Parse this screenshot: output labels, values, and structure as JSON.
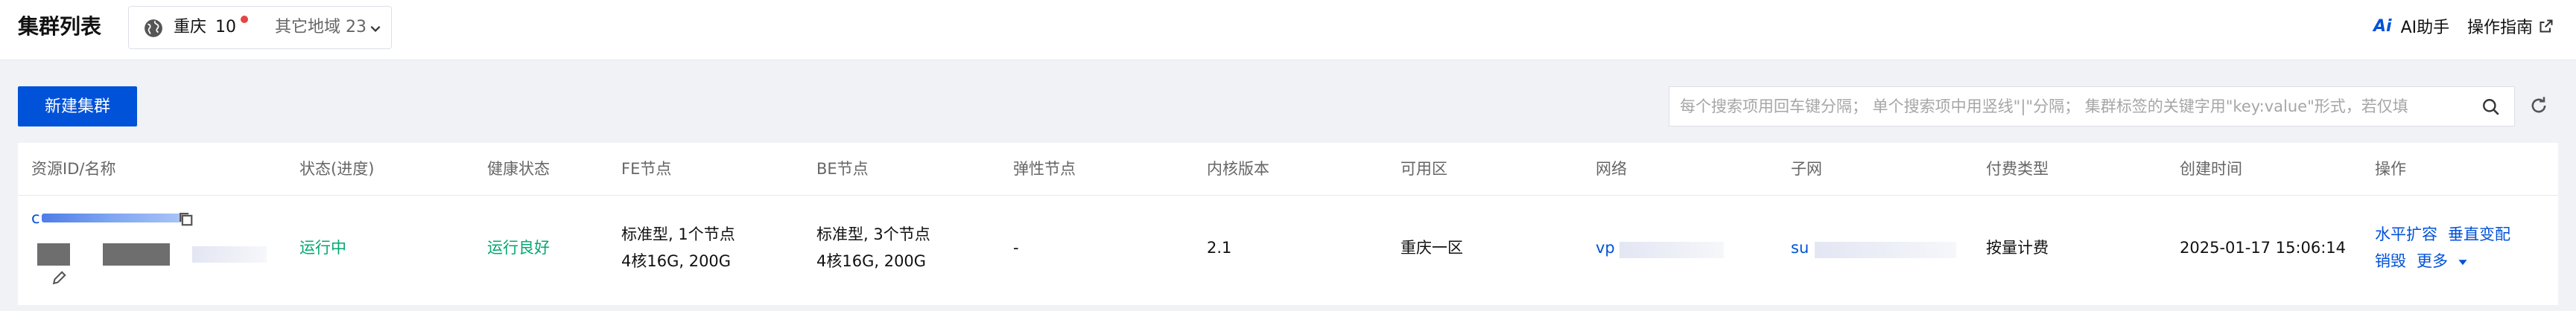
{
  "header": {
    "title": "集群列表",
    "region": {
      "name": "重庆",
      "count": "10",
      "icon": "globe-icon"
    },
    "other_region": "其它地域 23",
    "ai_assistant": "AI助手",
    "ai_icon_text": "Ai",
    "guide": "操作指南"
  },
  "toolbar": {
    "create_label": "新建集群",
    "search_placeholder": "每个搜索项用回车键分隔； 单个搜索项中用竖线\"|\"分隔； 集群标签的关键字用\"key:value\"形式，若仅填"
  },
  "table": {
    "columns": [
      "资源ID/名称",
      "状态(进度)",
      "健康状态",
      "FE节点",
      "BE节点",
      "弹性节点",
      "内核版本",
      "可用区",
      "网络",
      "子网",
      "付费类型",
      "创建时间",
      "操作"
    ],
    "rows": [
      {
        "id_prefix": "c",
        "status": "运行中",
        "health": "运行良好",
        "fe_line1": "标准型, 1个节点",
        "fe_line2": "4核16G, 200G",
        "be_line1": "标准型, 3个节点",
        "be_line2": "4核16G, 200G",
        "elastic": "-",
        "kernel": "2.1",
        "zone": "重庆一区",
        "network_prefix": "vp",
        "subnet_prefix": "su",
        "billing": "按量计费",
        "created": "2025-01-17 15:06:14",
        "actions": {
          "scale_out": "水平扩容",
          "scale_up": "垂直变配",
          "destroy": "销毁",
          "more": "更多"
        }
      }
    ]
  },
  "colors": {
    "primary": "#0052d9",
    "success": "#00a870",
    "badge": "#e54545"
  }
}
